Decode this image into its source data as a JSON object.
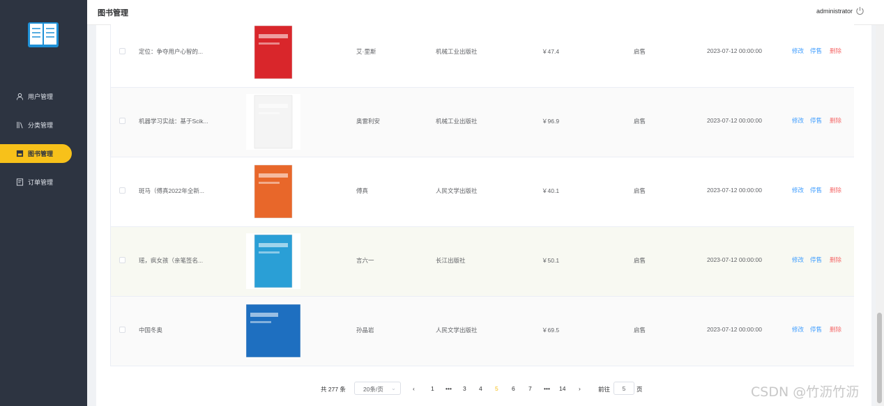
{
  "app": {
    "title": "图书管理",
    "user": "administrator"
  },
  "sidebar": {
    "items": [
      {
        "label": "用户管理",
        "icon": "user-icon",
        "active": false
      },
      {
        "label": "分类管理",
        "icon": "category-icon",
        "active": false
      },
      {
        "label": "图书管理",
        "icon": "book-icon",
        "active": true
      },
      {
        "label": "订单管理",
        "icon": "order-icon",
        "active": false
      }
    ]
  },
  "table": {
    "rows": [
      {
        "name": "定位：争夺用户心智的...",
        "author": "艾·里斯",
        "publisher": "机械工业出版社",
        "price": "￥47.4",
        "status": "启售",
        "date": "2023-07-12 00:00:00",
        "cover_color": "#d9262b"
      },
      {
        "name": "机器学习实战：基于Scik...",
        "author": "奥雷利安",
        "publisher": "机械工业出版社",
        "price": "￥96.9",
        "status": "启售",
        "date": "2023-07-12 00:00:00",
        "cover_color": "#f4f4f4"
      },
      {
        "name": "斑马（傅真2022年全新...",
        "author": "傅真",
        "publisher": "人民文学出版社",
        "price": "￥40.1",
        "status": "启售",
        "date": "2023-07-12 00:00:00",
        "cover_color": "#e8672a"
      },
      {
        "name": "瑶，疯女孩（亲笔签名...",
        "author": "言六一",
        "publisher": "长江出版社",
        "price": "￥50.1",
        "status": "启售",
        "date": "2023-07-12 00:00:00",
        "cover_color": "#2a9fd6"
      },
      {
        "name": "中国冬奥",
        "author": "孙晶岩",
        "publisher": "人民文学出版社",
        "price": "￥69.5",
        "status": "启售",
        "date": "2023-07-12 00:00:00",
        "cover_color": "#1e6fc0"
      }
    ],
    "actions": {
      "edit": "修改",
      "stop": "停售",
      "delete": "删除"
    }
  },
  "pager": {
    "total": "共 277 条",
    "size": "20条/页",
    "pages": [
      "1",
      "•••",
      "3",
      "4",
      "5",
      "6",
      "7",
      "•••",
      "14"
    ],
    "current": "5",
    "goto": "前往",
    "goto_value": "5",
    "page_unit": "页"
  },
  "watermark": "CSDN @竹沥竹沥",
  "colors": {
    "sidebar": "#2d3441",
    "accent": "#f7c11a",
    "link": "#409eff",
    "danger": "#f56c6c"
  }
}
